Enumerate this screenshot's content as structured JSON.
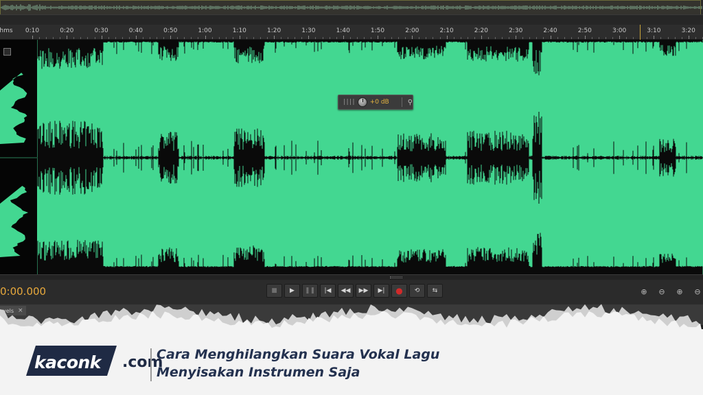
{
  "ruler": {
    "unit_label": "hms",
    "ticks": [
      "0:10",
      "0:20",
      "0:30",
      "0:40",
      "0:50",
      "1:00",
      "1:10",
      "1:20",
      "1:30",
      "1:40",
      "1:50",
      "2:00",
      "2:10",
      "2:20",
      "2:30",
      "2:40",
      "2:50",
      "3:00",
      "3:10",
      "3:20"
    ]
  },
  "waveform": {
    "color": "#43d791",
    "trace_color": "#0a0a0a"
  },
  "hud": {
    "bars": "||||",
    "value": "+0 dB",
    "pin_icon": "pin-icon"
  },
  "transport": {
    "time": "0:00.000",
    "buttons": [
      {
        "name": "stop-button",
        "icon": "stop-icon",
        "glyph": "■"
      },
      {
        "name": "play-button",
        "icon": "play-icon",
        "glyph": "▶"
      },
      {
        "name": "pause-button",
        "icon": "pause-icon",
        "glyph": "❚❚"
      },
      {
        "name": "go-to-start-button",
        "icon": "skip-back-icon",
        "glyph": "|◀"
      },
      {
        "name": "rewind-button",
        "icon": "rewind-icon",
        "glyph": "◀◀"
      },
      {
        "name": "fast-forward-button",
        "icon": "fast-forward-icon",
        "glyph": "▶▶"
      },
      {
        "name": "go-to-end-button",
        "icon": "skip-forward-icon",
        "glyph": "▶|"
      },
      {
        "name": "record-button",
        "icon": "record-icon",
        "glyph": "●"
      },
      {
        "name": "loop-button",
        "icon": "loop-icon",
        "glyph": "⟲"
      },
      {
        "name": "skip-selection-button",
        "icon": "skip-selection-icon",
        "glyph": "⇆"
      }
    ],
    "zoom_buttons": [
      {
        "name": "zoom-in-amplitude-button",
        "icon": "zoom-in-amplitude-icon",
        "glyph": "⊕"
      },
      {
        "name": "zoom-out-amplitude-button",
        "icon": "zoom-out-amplitude-icon",
        "glyph": "⊖"
      },
      {
        "name": "zoom-in-time-button",
        "icon": "zoom-in-time-icon",
        "glyph": "⊕"
      },
      {
        "name": "zoom-out-time-button",
        "icon": "zoom-out-time-icon",
        "glyph": "⊖"
      }
    ]
  },
  "panel": {
    "tab_label": "vels",
    "close_glyph": "×"
  },
  "banner": {
    "logo_text": "kaconk",
    "logo_suffix": ".com",
    "headline_line1": "Cara Menghilangkan Suara Vokal Lagu",
    "headline_line2": "Menyisakan Instrumen Saja",
    "headline_color": "#23314f",
    "logo_bg": "#1f2a44"
  }
}
